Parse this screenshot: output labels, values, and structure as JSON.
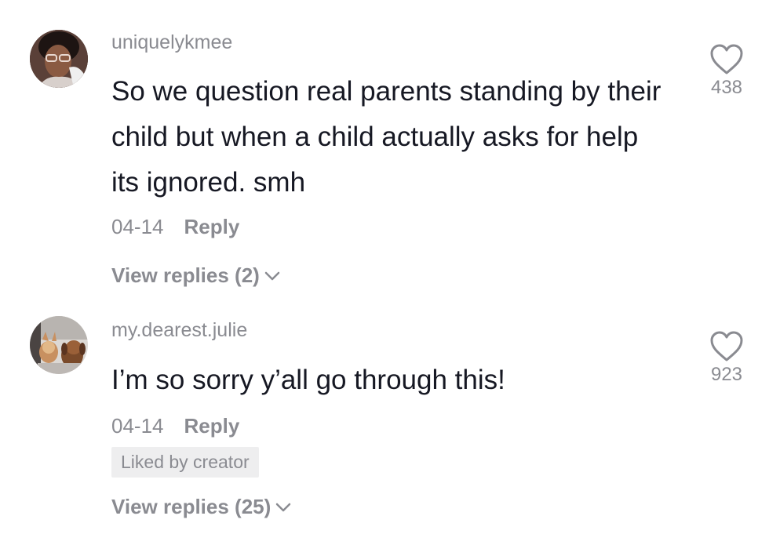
{
  "comments": [
    {
      "username": "uniquelykmee",
      "text": "So we question real parents standing by their child but when a child actually asks for help its ignored. smh",
      "date": "04-14",
      "reply_label": "Reply",
      "view_replies": "View replies (2)",
      "likes": "438"
    },
    {
      "username": "my.dearest.julie",
      "text": "I’m so sorry y’all go through this!",
      "date": "04-14",
      "reply_label": "Reply",
      "badge": "Liked by creator",
      "view_replies": "View replies (25)",
      "likes": "923"
    }
  ],
  "icons": {
    "like": "heart-outline-icon",
    "expand": "chevron-down-icon"
  },
  "colors": {
    "text_primary": "#161823",
    "text_secondary": "#8a8b91",
    "badge_bg": "#eeeeef"
  }
}
